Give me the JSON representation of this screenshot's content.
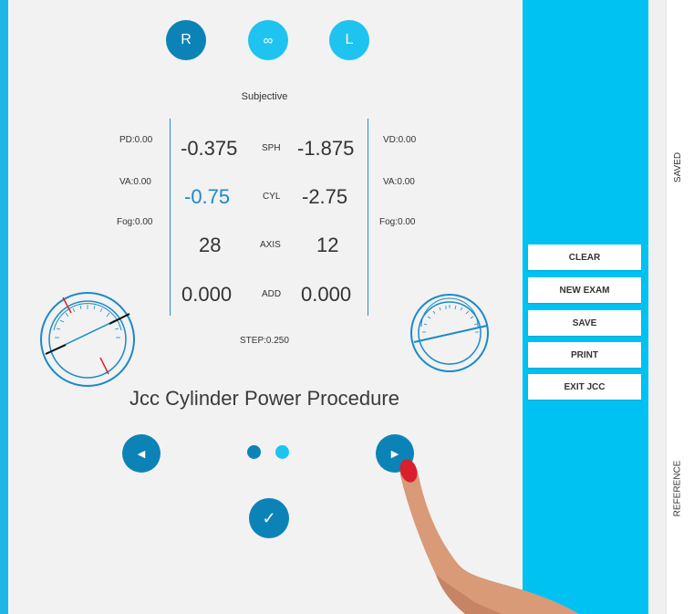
{
  "header": {
    "eye_right": "R",
    "eye_both": "∞",
    "eye_left": "L"
  },
  "exam": {
    "section_title": "Subjective",
    "left": {
      "pd": "PD:0.00",
      "va": "VA:0.00",
      "fog": "Fog:0.00"
    },
    "right": {
      "vd": "VD:0.00",
      "va": "VA:0.00",
      "fog": "Fog:0.00"
    },
    "rows": [
      {
        "label": "SPH",
        "right_value": "-0.375",
        "left_value": "-1.875"
      },
      {
        "label": "CYL",
        "right_value": "-0.75",
        "left_value": "-2.75"
      },
      {
        "label": "AXIS",
        "right_value": "28",
        "left_value": "12"
      },
      {
        "label": "ADD",
        "right_value": "0.000",
        "left_value": "0.000"
      }
    ],
    "step": "STEP:0.250"
  },
  "procedure": {
    "title": "Jcc Cylinder Power Procedure",
    "page_index": 0,
    "page_count": 2
  },
  "actions": {
    "clear": "CLEAR",
    "new_exam": "NEW EXAM",
    "save": "SAVE",
    "print": "PRINT",
    "exit_jcc": "EXIT JCC"
  },
  "side_tabs": {
    "saved": "SAVED",
    "reference": "REFERENCE"
  },
  "colors": {
    "accent": "#00c2f2",
    "primary_dark": "#0c83b7",
    "value_highlight": "#1a8ac7"
  },
  "icons": [
    "prev-arrow-icon",
    "next-arrow-icon",
    "check-icon",
    "axis-gauge-icon"
  ]
}
